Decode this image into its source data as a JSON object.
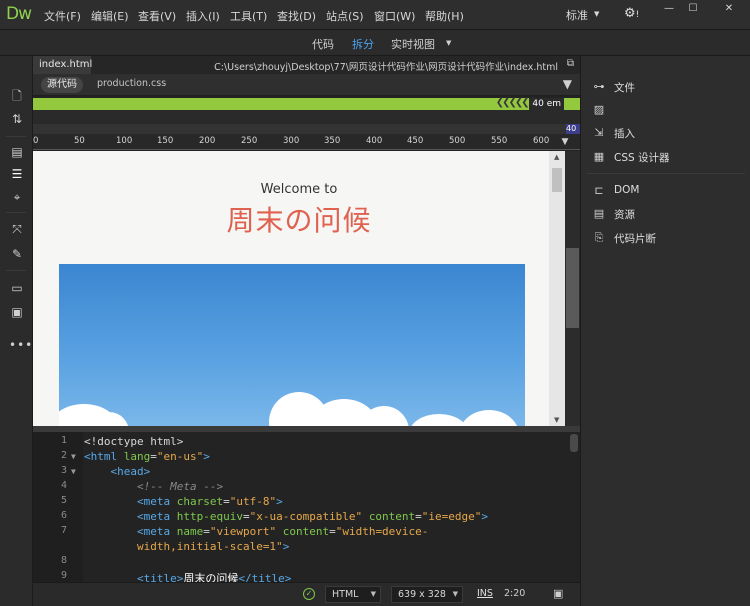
{
  "app": {
    "logo": "Dw",
    "menu": [
      "文件(F)",
      "编辑(E)",
      "查看(V)",
      "插入(I)",
      "工具(T)",
      "查找(D)",
      "站点(S)",
      "窗口(W)",
      "帮助(H)"
    ],
    "workspace": "标准",
    "settings_icon": "gear-icon"
  },
  "view_modes": {
    "items": [
      "代码",
      "拆分",
      "实时视图"
    ],
    "active": "拆分"
  },
  "document": {
    "tab": "index.html",
    "path": "C:\\Users\\zhouyj\\Desktop\\77\\网页设计代码作业\\网页设计代码作业\\index.html",
    "related": {
      "source": "源代码",
      "files": [
        "production.css"
      ]
    }
  },
  "media_query": {
    "value": "40  em",
    "secondary": "40"
  },
  "ruler": {
    "labels": [
      "0",
      "50",
      "100",
      "150",
      "200",
      "250",
      "300",
      "350",
      "400",
      "450",
      "500",
      "550",
      "600"
    ]
  },
  "design": {
    "welcome": "Welcome to",
    "title": "周末の问候",
    "hero_image": "sky-with-clouds"
  },
  "code": {
    "line_numbers": [
      "1",
      "2",
      "3",
      "4",
      "5",
      "6",
      "7",
      "",
      "8",
      "9"
    ],
    "lines": [
      [
        {
          "t": "plain",
          "s": "<!doctype html>"
        }
      ],
      [
        {
          "t": "tag",
          "s": "<html "
        },
        {
          "t": "attr",
          "s": "lang"
        },
        {
          "t": "plain",
          "s": "="
        },
        {
          "t": "val",
          "s": "\"en-us\""
        },
        {
          "t": "tag",
          "s": ">"
        }
      ],
      [
        {
          "t": "plain",
          "s": "    "
        },
        {
          "t": "tag",
          "s": "<head>"
        }
      ],
      [
        {
          "t": "plain",
          "s": "        "
        },
        {
          "t": "comment",
          "s": "<!-- Meta -->"
        }
      ],
      [
        {
          "t": "plain",
          "s": "        "
        },
        {
          "t": "tag",
          "s": "<meta "
        },
        {
          "t": "attr",
          "s": "charset"
        },
        {
          "t": "plain",
          "s": "="
        },
        {
          "t": "val",
          "s": "\"utf-8\""
        },
        {
          "t": "tag",
          "s": ">"
        }
      ],
      [
        {
          "t": "plain",
          "s": "        "
        },
        {
          "t": "tag",
          "s": "<meta "
        },
        {
          "t": "attr",
          "s": "http-equiv"
        },
        {
          "t": "plain",
          "s": "="
        },
        {
          "t": "val",
          "s": "\"x-ua-compatible\""
        },
        {
          "t": "plain",
          "s": " "
        },
        {
          "t": "attr",
          "s": "content"
        },
        {
          "t": "plain",
          "s": "="
        },
        {
          "t": "val",
          "s": "\"ie=edge\""
        },
        {
          "t": "tag",
          "s": ">"
        }
      ],
      [
        {
          "t": "plain",
          "s": "        "
        },
        {
          "t": "tag",
          "s": "<meta "
        },
        {
          "t": "attr",
          "s": "name"
        },
        {
          "t": "plain",
          "s": "="
        },
        {
          "t": "val",
          "s": "\"viewport\""
        },
        {
          "t": "plain",
          "s": " "
        },
        {
          "t": "attr",
          "s": "content"
        },
        {
          "t": "plain",
          "s": "="
        },
        {
          "t": "val",
          "s": "\"width=device-"
        }
      ],
      [
        {
          "t": "plain",
          "s": "        "
        },
        {
          "t": "val",
          "s": "width,initial-scale=1\""
        },
        {
          "t": "tag",
          "s": ">"
        }
      ],
      [],
      [
        {
          "t": "plain",
          "s": "        "
        },
        {
          "t": "tag",
          "s": "<title>"
        },
        {
          "t": "text",
          "s": "周末の问候"
        },
        {
          "t": "tag",
          "s": "</title>"
        }
      ]
    ]
  },
  "status": {
    "language": "HTML",
    "size": "639 x 328",
    "mode": "INS",
    "position": "2:20"
  },
  "right_panel": {
    "items": [
      {
        "label": "文件",
        "icon": "sitemap-icon"
      },
      {
        "label": "",
        "icon": "assets-image-icon"
      },
      {
        "label": "插入",
        "icon": "insert-icon"
      },
      {
        "label": "CSS 设计器",
        "icon": "css-designer-icon"
      },
      {
        "label": "DOM",
        "icon": "dom-tree-icon"
      },
      {
        "label": "资源",
        "icon": "assets-icon"
      },
      {
        "label": "代码片断",
        "icon": "snippets-icon"
      }
    ]
  }
}
